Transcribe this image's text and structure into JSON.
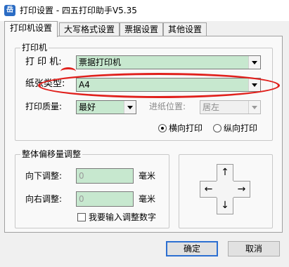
{
  "window": {
    "title": "打印设置 - 四五打印助手V5.35",
    "icon_letter": "岳"
  },
  "tabs": [
    {
      "label": "打印机设置",
      "active": true
    },
    {
      "label": "大写格式设置",
      "active": false
    },
    {
      "label": "票据设置",
      "active": false
    },
    {
      "label": "其他设置",
      "active": false
    }
  ],
  "printer_group": {
    "label": "打印机",
    "printer_label": "打 印 机:",
    "printer_value": "票据打印机",
    "paper_type_label": "纸张类型:",
    "paper_type_value": "A4",
    "quality_label": "打印质量:",
    "quality_value": "最好",
    "feed_label": "进纸位置:",
    "feed_value": "居左",
    "orientation": {
      "landscape_label": "横向打印",
      "portrait_label": "纵向打印",
      "selected": "landscape"
    }
  },
  "offset_group": {
    "label": "整体偏移量调整",
    "down_label": "向下调整:",
    "down_value": "0",
    "down_unit": "毫米",
    "right_label": "向右调整:",
    "right_value": "0",
    "right_unit": "毫米",
    "manual_input_label": "我要输入调整数字",
    "manual_input_checked": false
  },
  "dpad": {
    "up": "↑",
    "down": "↓",
    "left": "←",
    "right": "→"
  },
  "buttons": {
    "ok": "确定",
    "cancel": "取消"
  },
  "colors": {
    "field_green": "#c7e8cf",
    "annotation_red": "#e0201c",
    "focus_blue": "#2c6fd1"
  }
}
